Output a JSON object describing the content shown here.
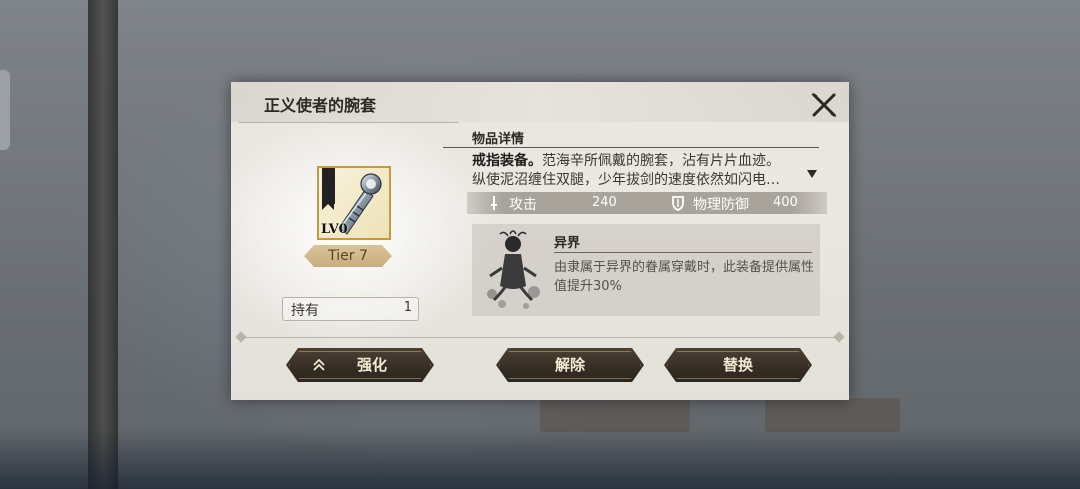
{
  "dialog": {
    "title": "正义使者的腕套"
  },
  "item": {
    "level": "LV0",
    "tier": "Tier 7",
    "hold_label": "持有",
    "hold_count": "1"
  },
  "details": {
    "section_title": "物品详情",
    "desc_bold": "戒指装备。",
    "desc_rest": "范海辛所佩戴的腕套，沾有片片血迹。",
    "desc_line2": "纵使泥沼缠住双腿，少年拔剑的速度依然如闪电…",
    "stats": [
      {
        "label": "攻击",
        "value": "240",
        "icon": "sword-icon"
      },
      {
        "label": "物理防御",
        "value": "400",
        "icon": "shield-icon"
      }
    ]
  },
  "world": {
    "title": "异界",
    "desc": "由隶属于异界的眷属穿戴时，此装备提供属性值提升30%"
  },
  "buttons": {
    "enhance": "强化",
    "remove": "解除",
    "replace": "替换"
  },
  "colors": {
    "button_bg": "#352d24",
    "frame_gold": "#c39a3f",
    "tier_tag": "#d9c49a"
  }
}
